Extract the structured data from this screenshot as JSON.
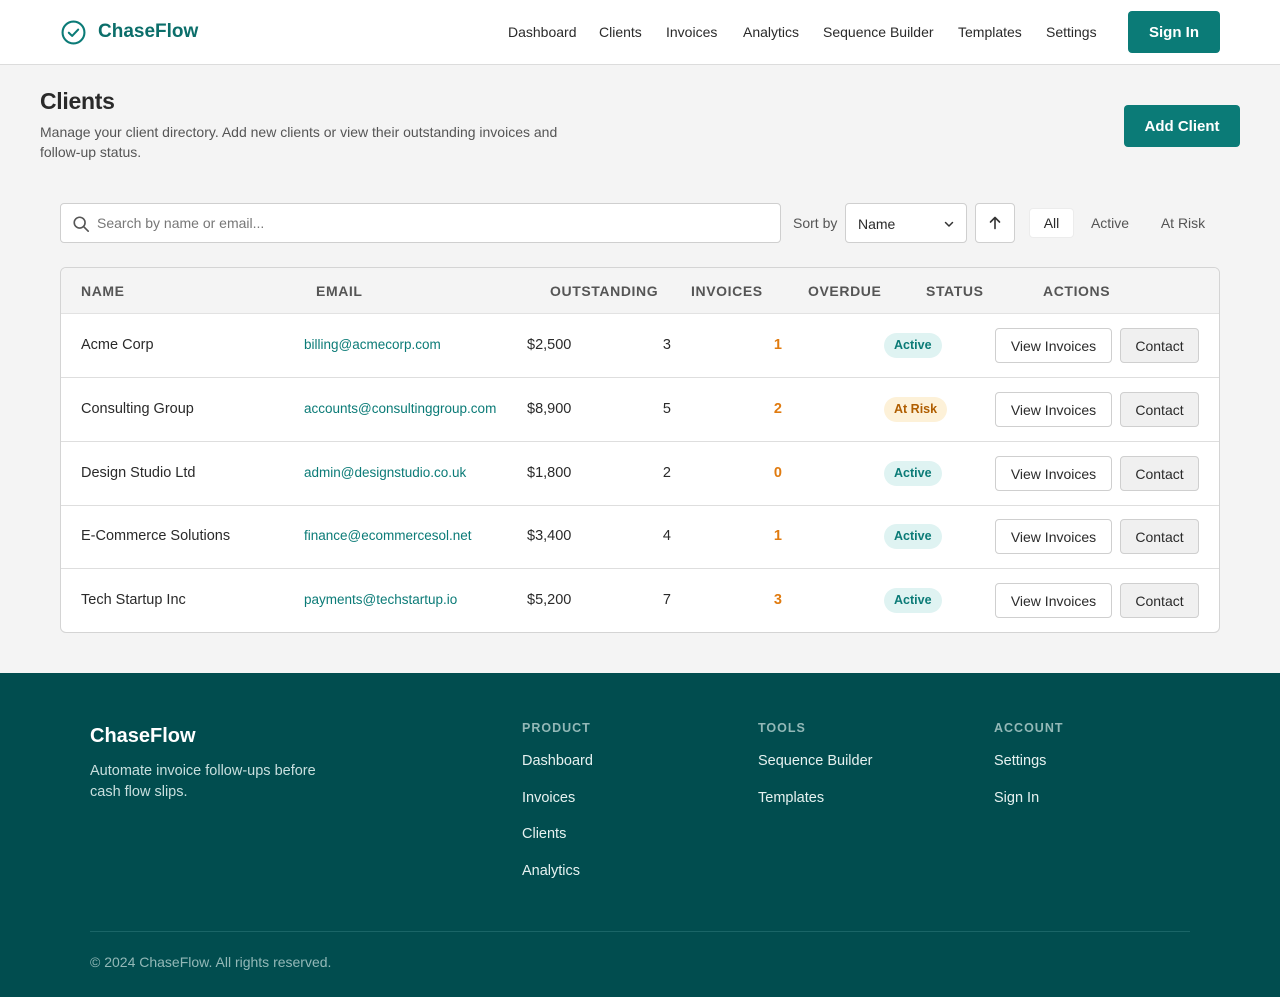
{
  "app": {
    "name": "ChaseFlow",
    "accent": "#0b7b77",
    "footer_bg": "#014d4f"
  },
  "header": {
    "logo_icon": "check-circle-icon",
    "nav": [
      "Dashboard",
      "Clients",
      "Invoices",
      "Analytics",
      "Sequence Builder",
      "Templates",
      "Settings"
    ],
    "sign_in": "Sign In"
  },
  "page": {
    "title": "Clients",
    "description": "Manage your client directory. Add new clients or view their outstanding invoices and follow-up status.",
    "add_button": "Add Client"
  },
  "controls": {
    "search_placeholder": "Search by name or email...",
    "search_value": "",
    "sort_label": "Sort by",
    "sort_value": "Name",
    "sort_direction_icon": "arrow-up-icon",
    "filters": [
      "All",
      "Active",
      "At Risk"
    ],
    "active_filter": "All"
  },
  "table": {
    "columns": [
      "NAME",
      "EMAIL",
      "OUTSTANDING",
      "INVOICES",
      "OVERDUE",
      "STATUS",
      "ACTIONS"
    ],
    "rows": [
      {
        "name": "Acme Corp",
        "email": "billing@acmecorp.com",
        "outstanding": "$2,500",
        "invoices": "3",
        "overdue": "1",
        "status": "Active",
        "status_type": "active",
        "view": "View Invoices",
        "contact": "Contact"
      },
      {
        "name": "Consulting Group",
        "email": "accounts@consultinggroup.com",
        "outstanding": "$8,900",
        "invoices": "5",
        "overdue": "2",
        "status": "At Risk",
        "status_type": "risk",
        "view": "View Invoices",
        "contact": "Contact"
      },
      {
        "name": "Design Studio Ltd",
        "email": "admin@designstudio.co.uk",
        "outstanding": "$1,800",
        "invoices": "2",
        "overdue": "0",
        "status": "Active",
        "status_type": "active",
        "view": "View Invoices",
        "contact": "Contact"
      },
      {
        "name": "E-Commerce Solutions",
        "email": "finance@ecommercesol.net",
        "outstanding": "$3,400",
        "invoices": "4",
        "overdue": "1",
        "status": "Active",
        "status_type": "active",
        "view": "View Invoices",
        "contact": "Contact"
      },
      {
        "name": "Tech Startup Inc",
        "email": "payments@techstartup.io",
        "outstanding": "$5,200",
        "invoices": "7",
        "overdue": "3",
        "status": "Active",
        "status_type": "active",
        "view": "View Invoices",
        "contact": "Contact"
      }
    ]
  },
  "footer": {
    "brand": "ChaseFlow",
    "tagline": "Automate invoice follow-ups before cash flow slips.",
    "columns": [
      {
        "title": "PRODUCT",
        "links": [
          "Dashboard",
          "Invoices",
          "Clients",
          "Analytics"
        ]
      },
      {
        "title": "TOOLS",
        "links": [
          "Sequence Builder",
          "Templates"
        ]
      },
      {
        "title": "ACCOUNT",
        "links": [
          "Settings",
          "Sign In"
        ]
      }
    ],
    "copyright": "© 2024 ChaseFlow. All rights reserved."
  }
}
